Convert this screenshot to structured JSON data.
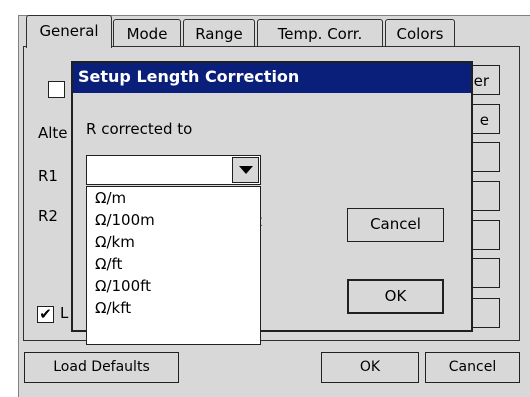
{
  "tabs": [
    {
      "label": "General"
    },
    {
      "label": "Mode"
    },
    {
      "label": "Range"
    },
    {
      "label": "Temp. Corr."
    },
    {
      "label": "Colors"
    }
  ],
  "general": {
    "alt_label_partial": "Alte",
    "r1_label": "R1",
    "r2_label": "R2",
    "bottom_check_partial": "L",
    "side_btn_1_partial": "er",
    "side_btn_2_partial": "e"
  },
  "dialog": {
    "title": "Setup Length Correction",
    "r_corrected_label": "R corrected to",
    "unit_select_value": "",
    "unit_options": [
      "Ω/m",
      "Ω/100m",
      "Ω/km",
      "Ω/ft",
      "Ω/100ft",
      "Ω/kft"
    ],
    "hidden_text_partial": "t",
    "cancel_label": "Cancel",
    "ok_label": "OK"
  },
  "footer": {
    "load_defaults_label": "Load Defaults",
    "ok_label": "OK",
    "cancel_label": "Cancel"
  }
}
